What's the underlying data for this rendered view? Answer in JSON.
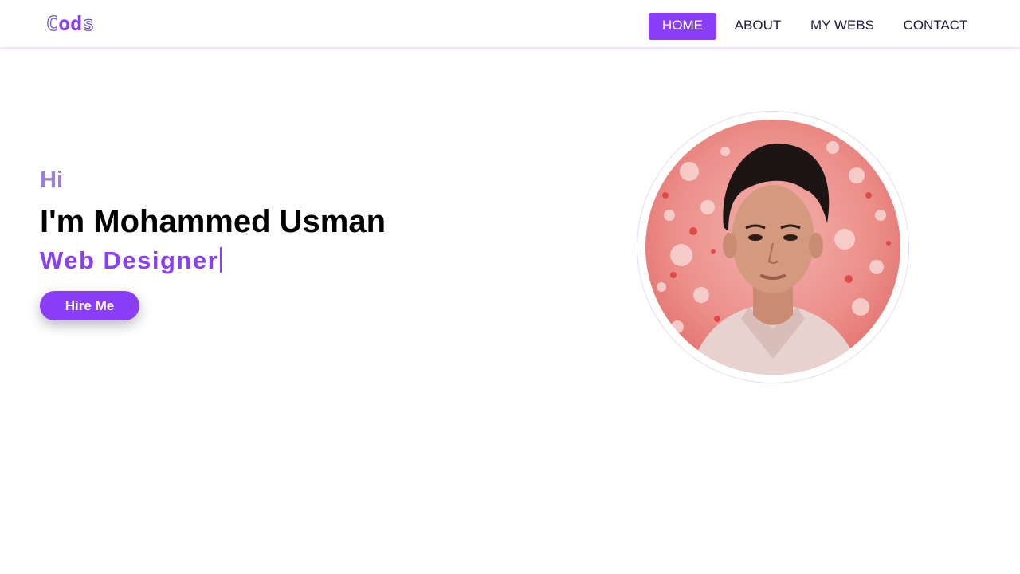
{
  "brand": {
    "logo_letters": [
      "C",
      "o",
      "d",
      "s"
    ],
    "logo_color": "#8a3ef7"
  },
  "nav": {
    "items": [
      {
        "label": "HOME",
        "active": true
      },
      {
        "label": "ABOUT",
        "active": false
      },
      {
        "label": "MY WEBS",
        "active": false
      },
      {
        "label": "CONTACT",
        "active": false
      }
    ]
  },
  "hero": {
    "greeting": "Hi",
    "name": "I'm Mohammed Usman",
    "role": "Web Designer",
    "cta_label": "Hire Me",
    "accent_color": "#8a3ef7",
    "greeting_color": "#9a7fd6"
  },
  "portrait": {
    "icon": "profile-photo"
  }
}
